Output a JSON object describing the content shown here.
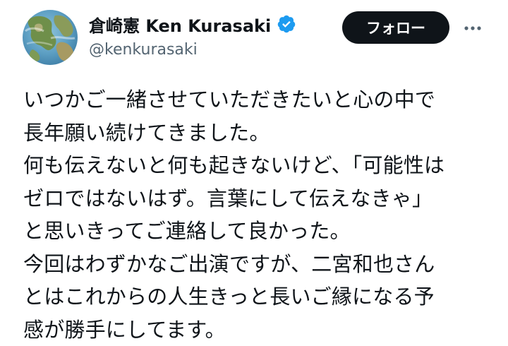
{
  "author": {
    "display_name": "倉崎憲 Ken Kurasaki",
    "handle": "@kenkurasaki",
    "verified_icon": "verified-badge-icon",
    "avatar_icon": "globe-avatar-icon"
  },
  "actions": {
    "follow_label": "フォロー",
    "more_icon": "more-horizontal-icon"
  },
  "colors": {
    "text_primary": "#0f1419",
    "text_secondary": "#536471",
    "verified_blue": "#1d9bf0",
    "follow_bg": "#0f1419",
    "follow_text": "#ffffff"
  },
  "tweet": {
    "lines": [
      "いつかご一緒させていただきたいと心の中で",
      "長年願い続けてきました。",
      "何も伝えないと何も起きないけど、「可能性は",
      "ゼロではないはず。言葉にして伝えなきゃ」",
      "と思いきってご連絡して良かった。",
      "今回はわずかなご出演ですが、二宮和也さん",
      "とはこれからの人生きっと長いご縁になる予",
      "感が勝手にしてます。"
    ]
  }
}
